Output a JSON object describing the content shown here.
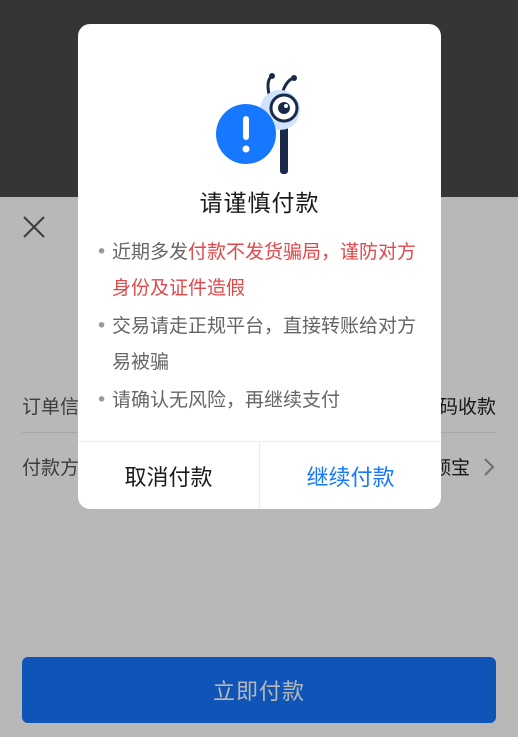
{
  "page": {
    "order_label": "订单信息",
    "order_value": "二维码收款",
    "method_label": "付款方式",
    "method_value": "余额宝",
    "pay_button": "立即付款"
  },
  "dialog": {
    "title": "请谨慎付款",
    "bullet1_normal": "近期多发",
    "bullet1_warn": "付款不发货骗局，谨防对方身份及证件造假",
    "bullet2": "交易请走正规平台，直接转账给对方易被骗",
    "bullet3": "请确认无风险，再继续支付",
    "cancel_label": "取消付款",
    "continue_label": "继续付款"
  },
  "colors": {
    "accent": "#1677ff",
    "warning": "#e0484a"
  }
}
